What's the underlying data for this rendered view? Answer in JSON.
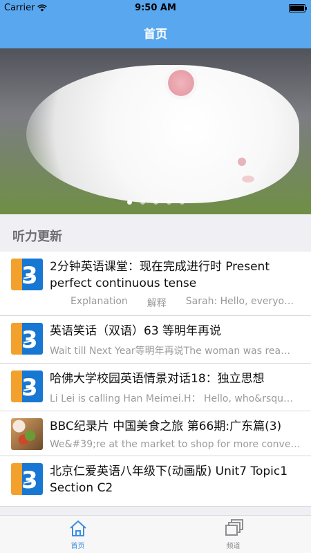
{
  "status": {
    "carrier": "Carrier",
    "time": "9:50 AM",
    "wifi_icon": "wifi-icon",
    "battery_icon": "battery-icon"
  },
  "navbar": {
    "title": "首页"
  },
  "banner": {
    "image_icon": "rabbit-photo",
    "page_count": 5,
    "active_page": 1
  },
  "section": {
    "title": "听力更新"
  },
  "items": [
    {
      "thumb": "logo",
      "title": "2分钟英语课堂：现在完成进行时 Present perfect continuous tense",
      "subparts": [
        "Explanation",
        "解释",
        "Sarah: Hello, everyo…"
      ]
    },
    {
      "thumb": "logo",
      "title": "英语笑话（双语）63 等明年再说",
      "subtitle": "Wait till Next Year等明年再说The woman was rea…"
    },
    {
      "thumb": "logo",
      "title": "哈佛大学校园英语情景对话18：独立思想",
      "subtitle": "Li Lei is calling Han Meimei.H： Hello, who&rsqu…"
    },
    {
      "thumb": "food",
      "title": "BBC纪录片 中国美食之旅 第66期:广东篇(3)",
      "subtitle": "We&#39;re at the market to shop for more conven…"
    },
    {
      "thumb": "logo",
      "title": "北京仁爱英语八年级下(动画版) Unit7 Topic1 Section C2",
      "subtitle": ""
    }
  ],
  "tabs": [
    {
      "label": "首页",
      "icon": "home-icon",
      "active": true
    },
    {
      "label": "频道",
      "icon": "stack-icon",
      "active": false
    }
  ],
  "colors": {
    "accent": "#59a7ee",
    "tab_active": "#3a8de2",
    "tab_inactive": "#8e8e93",
    "background": "#efeff4"
  }
}
